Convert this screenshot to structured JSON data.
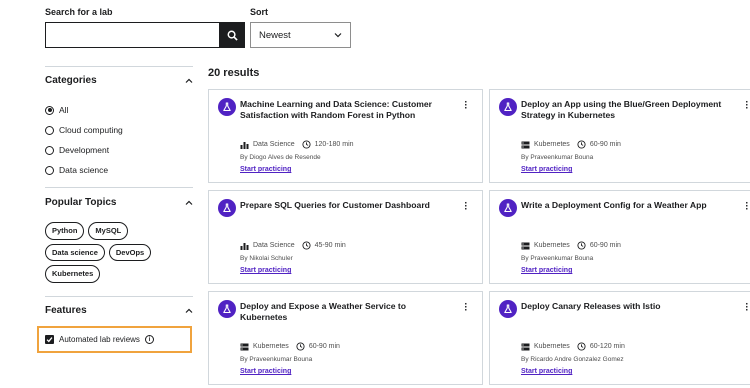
{
  "search": {
    "label": "Search for a lab",
    "placeholder": ""
  },
  "sort": {
    "label": "Sort",
    "value": "Newest"
  },
  "categories": {
    "title": "Categories",
    "items": [
      {
        "label": "All",
        "checked": true
      },
      {
        "label": "Cloud computing",
        "checked": false
      },
      {
        "label": "Development",
        "checked": false
      },
      {
        "label": "Data science",
        "checked": false
      }
    ]
  },
  "topics": {
    "title": "Popular Topics",
    "items": [
      "Python",
      "MySQL",
      "Data science",
      "DevOps",
      "Kubernetes"
    ]
  },
  "features": {
    "title": "Features",
    "automated_label": "Automated lab reviews",
    "automated_checked": true
  },
  "results_text": "20 results",
  "accent_color": "#5022c3",
  "highlight_color": "#f0a33d",
  "cards": [
    {
      "title": "Machine Learning and Data Science: Customer Satisfaction with Random Forest in Python",
      "category": "Data Science",
      "category_icon": "bar-chart-icon",
      "duration": "120-180 min",
      "author": "By Diogo Alves de Resende",
      "cta": "Start practicing"
    },
    {
      "title": "Deploy an App using the Blue/Green Deployment Strategy in Kubernetes",
      "category": "Kubernetes",
      "category_icon": "server-icon",
      "duration": "60-90 min",
      "author": "By Praveenkumar Bouna",
      "cta": "Start practicing"
    },
    {
      "title": "Prepare SQL Queries for Customer Dashboard",
      "category": "Data Science",
      "category_icon": "bar-chart-icon",
      "duration": "45-90 min",
      "author": "By Nikolai Schuler",
      "cta": "Start practicing"
    },
    {
      "title": "Write a Deployment Config for a Weather App",
      "category": "Kubernetes",
      "category_icon": "server-icon",
      "duration": "60-90 min",
      "author": "By Praveenkumar Bouna",
      "cta": "Start practicing"
    },
    {
      "title": "Deploy and Expose a Weather Service to Kubernetes",
      "category": "Kubernetes",
      "category_icon": "server-icon",
      "duration": "60-90 min",
      "author": "By Praveenkumar Bouna",
      "cta": "Start practicing"
    },
    {
      "title": "Deploy Canary Releases with Istio",
      "category": "Kubernetes",
      "category_icon": "server-icon",
      "duration": "60-120 min",
      "author": "By Ricardo Andre Gonzalez Gomez",
      "cta": "Start practicing"
    }
  ]
}
